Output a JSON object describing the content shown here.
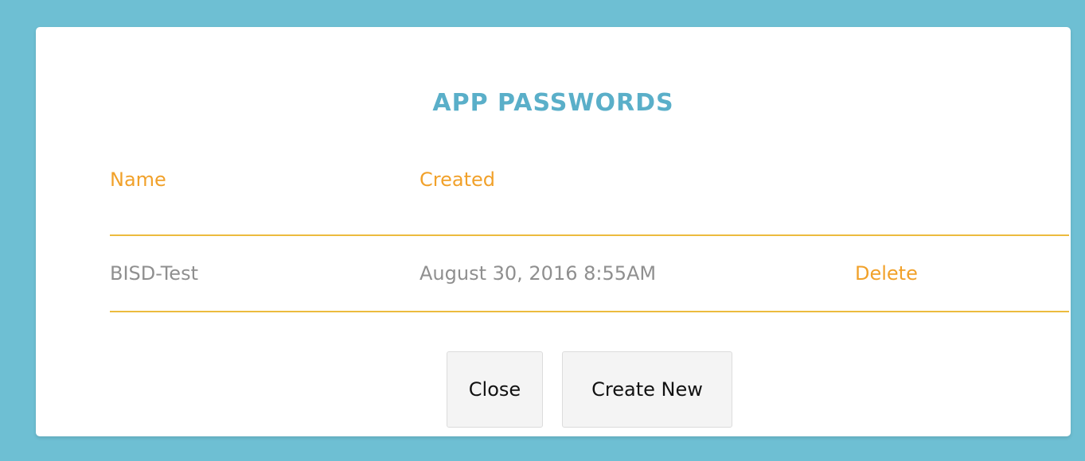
{
  "dialog": {
    "title": "APP PASSWORDS"
  },
  "table": {
    "columns": [
      "Name",
      "Created"
    ],
    "rows": [
      {
        "name": "BISD-Test",
        "created": "August 30, 2016 8:55AM",
        "action": "Delete"
      }
    ]
  },
  "buttons": {
    "close": "Close",
    "create_new": "Create New"
  },
  "colors": {
    "background": "#6ebfd3",
    "title": "#5aafc9",
    "accent": "#f1a12a",
    "rule": "#ecbb3e",
    "cell_text": "#8f8f8f"
  }
}
